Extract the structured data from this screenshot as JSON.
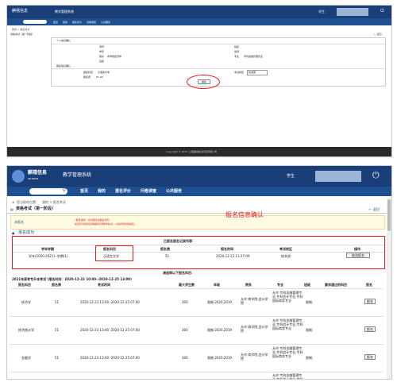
{
  "brand": {
    "name_cn": "麒禧信息",
    "name_en": "QILINXIN",
    "system": "教学管理系统"
  },
  "user": {
    "label": "学生",
    "avatar": "photo",
    "power": "power-icon"
  },
  "nav": {
    "items": [
      "首页",
      "我的",
      "报名评价",
      "问卷调查",
      "公共服务"
    ]
  },
  "breadcrumb": {
    "prefix": "您当前的位置：",
    "path": "我的 > 报名考试"
  },
  "panel": {
    "title": "资格考试（第一阶段）",
    "back": "← 返回"
  },
  "notice": {
    "tag": "未报名",
    "line1": "*报名说明：请仔细阅读报名须知",
    "line2": "如您有问题请咨询辅导员或教学秘书，以免影响您的报名。"
  },
  "status": {
    "success": "报名成功",
    "annotation": "报名信息确认"
  },
  "enrolled": {
    "title": "已报名报名记录列表：",
    "headers": [
      "学年学期",
      "报名科目",
      "报名费",
      "报名时间",
      "考试校区",
      "操作"
    ],
    "row": [
      "学年(2020-2021)--学期(1)",
      "汉语言文学",
      "51",
      "2020-12-23 11:27:09",
      "校本部",
      "取消报名"
    ]
  },
  "available": {
    "title": "请选择以下报名科目：",
    "exam_title": "2021年高考专升本考试 (报名时间：2020-12-22 10:00--2020-12-25 13:00)",
    "headers": [
      "报名科目",
      "报名费",
      "考试时间",
      "最大学生数",
      "年级",
      "院系",
      "专业",
      "班级",
      "要求通过的科目",
      "报名"
    ],
    "rows": [
      {
        "subject": "经济学",
        "fee": "51",
        "time": "2020-12-23 13:00 -2020-12-25 07:00",
        "max": "300",
        "grade": "限制:2020,2019",
        "dept": "允许:商学院,会计学院",
        "major": "允许:专科金融管理专业,专科会计专业,专科国际商务专业",
        "class": "限制:",
        "req": "",
        "action": "报名"
      },
      {
        "subject": "经济统计学",
        "fee": "51",
        "time": "2020-12-23 13:00 -2020-12-25 07:00",
        "max": "300",
        "grade": "限制:2020,2019",
        "dept": "允许:商学院,会计学院",
        "major": "允许:专科金融管理专业,专科会计专业,专科国际商务专业",
        "class": "限制:",
        "req": "",
        "action": "报名"
      },
      {
        "subject": "金融学",
        "fee": "51",
        "time": "2020-12-23 13:00 -2020-12-25 07:00",
        "max": "300",
        "grade": "限制:2020,2019",
        "dept": "允许:商学院,会计学院",
        "major": "允许:专科金融管理专业,专科会计专业,专科国际商务专业",
        "class": "限制:",
        "req": "",
        "action": "报名"
      },
      {
        "subject": "",
        "fee": "",
        "time": "",
        "max": "",
        "grade": "",
        "dept": "",
        "major": "允许:专科金融管理专业,专科会计专业,专科国际商务专业",
        "class": "",
        "req": "",
        "action": ""
      }
    ]
  },
  "top_screenshot": {
    "form_title": "个人信息确认",
    "rows": [
      [
        "学号",
        "",
        "姓名",
        ""
      ],
      [
        "学历",
        "",
        "性别",
        ""
      ],
      [
        "院系",
        "商学院经济学",
        "专业",
        "专科金融管理专业"
      ],
      [
        "班级",
        "",
        "",
        ""
      ]
    ],
    "section2": "报名信息确认",
    "subject_label": "报名科目",
    "subject_value": "汉语言文学",
    "campus_label": "考试校区",
    "campus_value": "校本部",
    "fee_label": "报名费",
    "fee_value": "51.00",
    "confirm": "报名",
    "footer": "Copyright © 2015 上海麒禧信息科技有限公司"
  },
  "colors": {
    "header": "#1a3f78",
    "nav": "#1d4f91",
    "accent_red": "#e02020",
    "notice_bg": "#fffbe0"
  }
}
